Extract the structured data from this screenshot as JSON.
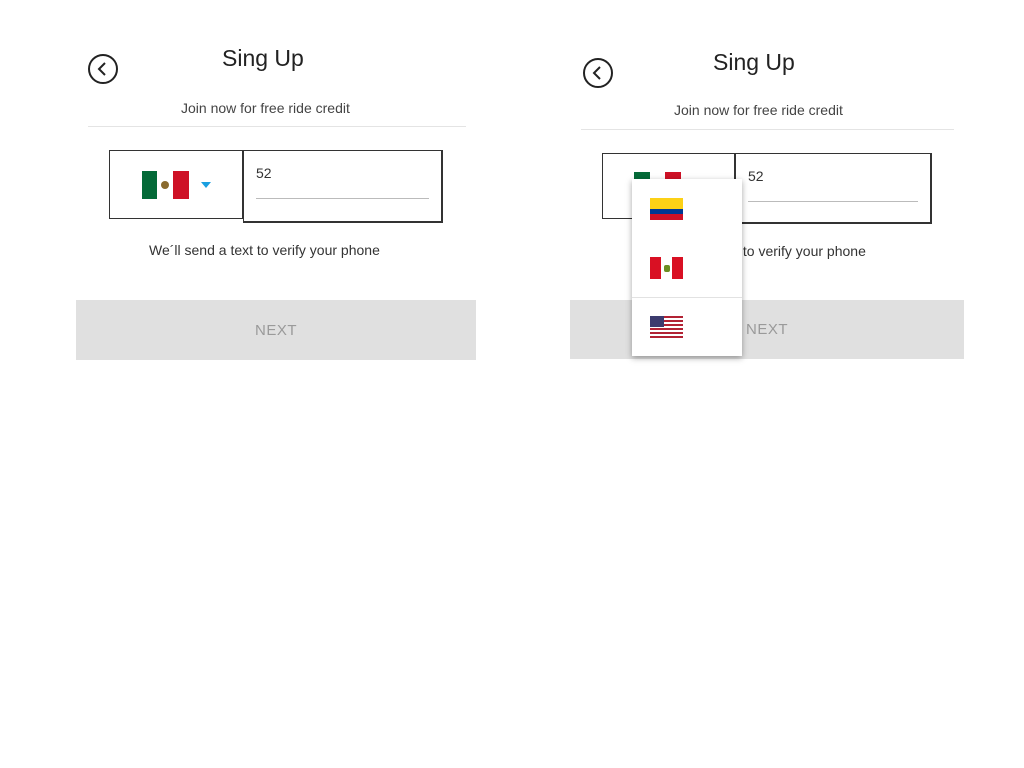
{
  "colors": {
    "accent": "#1a9fe0",
    "button_bg": "#e0e0e0",
    "button_text": "#9a9a9a"
  },
  "screens": [
    {
      "back_icon": "chevron-left-circle-icon",
      "title": "Sing Up",
      "subtitle": "Join now for free ride credit",
      "country": {
        "selected_flag": "mexico-flag-icon",
        "caret_icon": "caret-down-icon"
      },
      "phone": {
        "value": "52"
      },
      "helper": "We´ll send a text to verify your phone",
      "next_label": "NEXT"
    },
    {
      "back_icon": "chevron-left-circle-icon",
      "title": "Sing Up",
      "subtitle": "Join now for free ride credit",
      "country": {
        "selected_flag": "mexico-flag-icon",
        "caret_icon": "caret-down-icon"
      },
      "phone": {
        "value": "52"
      },
      "helper": "We´ll send a text to verify your phone",
      "next_label": "NEXT",
      "dropdown_options": [
        {
          "icon": "colombia-flag-icon"
        },
        {
          "icon": "peru-flag-icon"
        },
        {
          "icon": "usa-flag-icon"
        }
      ]
    }
  ]
}
